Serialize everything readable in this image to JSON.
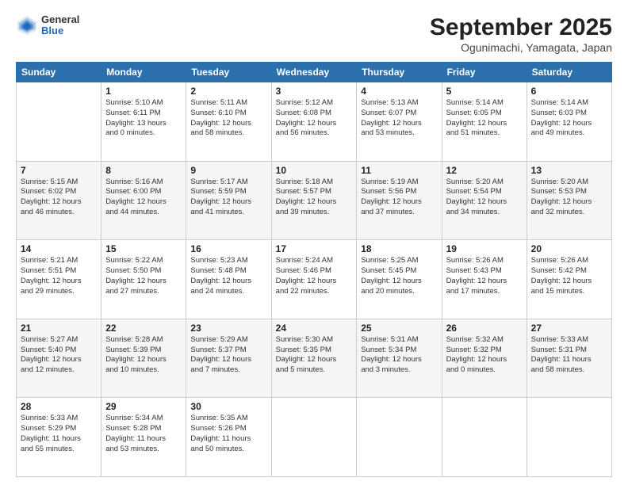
{
  "header": {
    "logo_general": "General",
    "logo_blue": "Blue",
    "title": "September 2025",
    "subtitle": "Ogunimachi, Yamagata, Japan"
  },
  "columns": [
    "Sunday",
    "Monday",
    "Tuesday",
    "Wednesday",
    "Thursday",
    "Friday",
    "Saturday"
  ],
  "weeks": [
    [
      {
        "day": "",
        "info": ""
      },
      {
        "day": "1",
        "info": "Sunrise: 5:10 AM\nSunset: 6:11 PM\nDaylight: 13 hours\nand 0 minutes."
      },
      {
        "day": "2",
        "info": "Sunrise: 5:11 AM\nSunset: 6:10 PM\nDaylight: 12 hours\nand 58 minutes."
      },
      {
        "day": "3",
        "info": "Sunrise: 5:12 AM\nSunset: 6:08 PM\nDaylight: 12 hours\nand 56 minutes."
      },
      {
        "day": "4",
        "info": "Sunrise: 5:13 AM\nSunset: 6:07 PM\nDaylight: 12 hours\nand 53 minutes."
      },
      {
        "day": "5",
        "info": "Sunrise: 5:14 AM\nSunset: 6:05 PM\nDaylight: 12 hours\nand 51 minutes."
      },
      {
        "day": "6",
        "info": "Sunrise: 5:14 AM\nSunset: 6:03 PM\nDaylight: 12 hours\nand 49 minutes."
      }
    ],
    [
      {
        "day": "7",
        "info": "Sunrise: 5:15 AM\nSunset: 6:02 PM\nDaylight: 12 hours\nand 46 minutes."
      },
      {
        "day": "8",
        "info": "Sunrise: 5:16 AM\nSunset: 6:00 PM\nDaylight: 12 hours\nand 44 minutes."
      },
      {
        "day": "9",
        "info": "Sunrise: 5:17 AM\nSunset: 5:59 PM\nDaylight: 12 hours\nand 41 minutes."
      },
      {
        "day": "10",
        "info": "Sunrise: 5:18 AM\nSunset: 5:57 PM\nDaylight: 12 hours\nand 39 minutes."
      },
      {
        "day": "11",
        "info": "Sunrise: 5:19 AM\nSunset: 5:56 PM\nDaylight: 12 hours\nand 37 minutes."
      },
      {
        "day": "12",
        "info": "Sunrise: 5:20 AM\nSunset: 5:54 PM\nDaylight: 12 hours\nand 34 minutes."
      },
      {
        "day": "13",
        "info": "Sunrise: 5:20 AM\nSunset: 5:53 PM\nDaylight: 12 hours\nand 32 minutes."
      }
    ],
    [
      {
        "day": "14",
        "info": "Sunrise: 5:21 AM\nSunset: 5:51 PM\nDaylight: 12 hours\nand 29 minutes."
      },
      {
        "day": "15",
        "info": "Sunrise: 5:22 AM\nSunset: 5:50 PM\nDaylight: 12 hours\nand 27 minutes."
      },
      {
        "day": "16",
        "info": "Sunrise: 5:23 AM\nSunset: 5:48 PM\nDaylight: 12 hours\nand 24 minutes."
      },
      {
        "day": "17",
        "info": "Sunrise: 5:24 AM\nSunset: 5:46 PM\nDaylight: 12 hours\nand 22 minutes."
      },
      {
        "day": "18",
        "info": "Sunrise: 5:25 AM\nSunset: 5:45 PM\nDaylight: 12 hours\nand 20 minutes."
      },
      {
        "day": "19",
        "info": "Sunrise: 5:26 AM\nSunset: 5:43 PM\nDaylight: 12 hours\nand 17 minutes."
      },
      {
        "day": "20",
        "info": "Sunrise: 5:26 AM\nSunset: 5:42 PM\nDaylight: 12 hours\nand 15 minutes."
      }
    ],
    [
      {
        "day": "21",
        "info": "Sunrise: 5:27 AM\nSunset: 5:40 PM\nDaylight: 12 hours\nand 12 minutes."
      },
      {
        "day": "22",
        "info": "Sunrise: 5:28 AM\nSunset: 5:39 PM\nDaylight: 12 hours\nand 10 minutes."
      },
      {
        "day": "23",
        "info": "Sunrise: 5:29 AM\nSunset: 5:37 PM\nDaylight: 12 hours\nand 7 minutes."
      },
      {
        "day": "24",
        "info": "Sunrise: 5:30 AM\nSunset: 5:35 PM\nDaylight: 12 hours\nand 5 minutes."
      },
      {
        "day": "25",
        "info": "Sunrise: 5:31 AM\nSunset: 5:34 PM\nDaylight: 12 hours\nand 3 minutes."
      },
      {
        "day": "26",
        "info": "Sunrise: 5:32 AM\nSunset: 5:32 PM\nDaylight: 12 hours\nand 0 minutes."
      },
      {
        "day": "27",
        "info": "Sunrise: 5:33 AM\nSunset: 5:31 PM\nDaylight: 11 hours\nand 58 minutes."
      }
    ],
    [
      {
        "day": "28",
        "info": "Sunrise: 5:33 AM\nSunset: 5:29 PM\nDaylight: 11 hours\nand 55 minutes."
      },
      {
        "day": "29",
        "info": "Sunrise: 5:34 AM\nSunset: 5:28 PM\nDaylight: 11 hours\nand 53 minutes."
      },
      {
        "day": "30",
        "info": "Sunrise: 5:35 AM\nSunset: 5:26 PM\nDaylight: 11 hours\nand 50 minutes."
      },
      {
        "day": "",
        "info": ""
      },
      {
        "day": "",
        "info": ""
      },
      {
        "day": "",
        "info": ""
      },
      {
        "day": "",
        "info": ""
      }
    ]
  ]
}
